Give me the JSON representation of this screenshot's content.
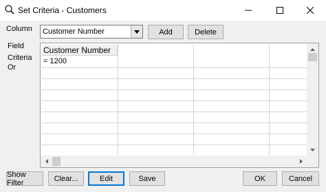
{
  "window": {
    "title": "Set Criteria - Customers"
  },
  "labels": {
    "column": "Column",
    "field": "Field",
    "criteria": "Criteria",
    "or": "Or"
  },
  "column_select": {
    "value": "Customer Number"
  },
  "buttons": {
    "add": "Add",
    "delete": "Delete",
    "show_filter": "Show Filter",
    "clear": "Clear...",
    "edit": "Edit",
    "save": "Save",
    "ok": "OK",
    "cancel": "Cancel"
  },
  "grid": {
    "header": "Customer Number",
    "criteria_value": "= 1200"
  },
  "icons": {
    "title": "magnifier-icon",
    "minimize": "minimize-icon",
    "maximize": "maximize-icon",
    "close": "close-icon"
  }
}
